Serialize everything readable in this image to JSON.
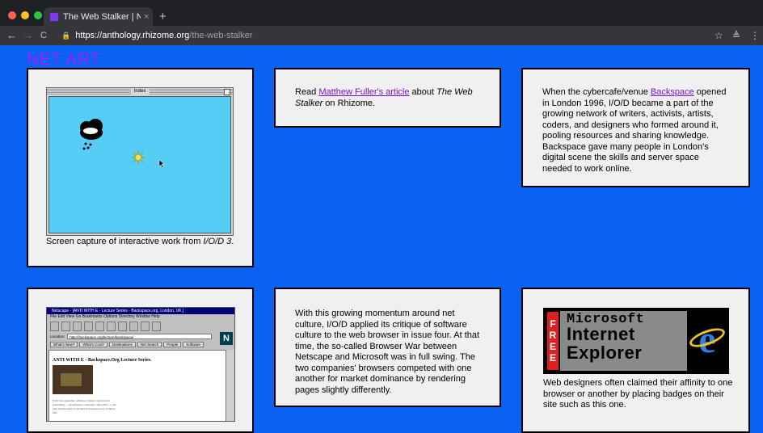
{
  "browser": {
    "tab_title": "The Web Stalker | Net Art Anth",
    "tab_close": "×",
    "new_tab": "+",
    "back": "←",
    "forward": "→",
    "reload": "C",
    "url_host": "https://anthology.rhizome.org",
    "url_path": "/the-web-stalker",
    "star": "☆",
    "ext": "≜",
    "menu": "⋮",
    "lights": [
      "#ff5f57",
      "#febc2e",
      "#28c840"
    ]
  },
  "page": {
    "title": "NET ART",
    "title_color": "#a020f0",
    "background": "#0a62f2"
  },
  "cards": {
    "screen1": {
      "window_title": "Index",
      "caption_pre": "Screen capture of interactive work from ",
      "caption_em": "I/O/D 3",
      "caption_post": "."
    },
    "fuller": {
      "pre": "Read ",
      "link": "Matthew Fuller's article",
      "mid": " about ",
      "em": "The Web Stalker",
      "post": " on Rhizome."
    },
    "backspace": {
      "pre": "When the cybercafe/venue ",
      "link": "Backspace",
      "post": " opened in London 1996, I/O/D became a part of the growing network of writers, activists, artists, coders, and designers who formed around it, pooling resources and sharing knowledge. Backspace gave many people in London's digital scene the skills and server space needed to work online."
    },
    "netscape": {
      "window_title": "Netscape - [ANTI WITH E - Lecture Series - Backspace.org, London, UK.]",
      "menu": "File  Edit  View  Go  Bookmarks  Options  Directory  Window  Help",
      "location_label": "Location:",
      "location_url": "http://backspace.org/lecture/backspace/",
      "links": [
        "What's New?",
        "What's Cool?",
        "Destinations",
        "Net Search",
        "People",
        "Software"
      ],
      "logo": "N",
      "heading": "ANTI WITH E - Backspace.Org Lecture Series.",
      "body": "Each live guestalist, whatever culture creation and interesting ... are pleased to announce 'anti with e', a one year lecture series to be held at backspace.org, London, UK."
    },
    "browserwar": {
      "text": "With this growing momentum around net culture, I/O/D applied its critique of software culture to the web browser in issue four. At that time, the so-called Browser War between Netscape and Microsoft was in full swing. The two companies' browsers competed with one another for market dominance by rendering pages slightly differently."
    },
    "ie": {
      "free_letters": [
        "F",
        "R",
        "E",
        "E"
      ],
      "line1": "Microsoft",
      "line2": "Internet",
      "line3": "Explorer",
      "ie_letter": "e",
      "caption": "Web designers often claimed their affinity to one browser or another by placing badges on their site such as this one."
    }
  }
}
